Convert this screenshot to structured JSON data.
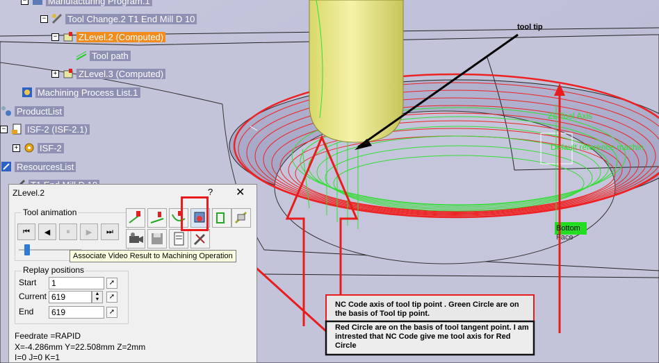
{
  "tree": {
    "items": [
      {
        "label": "Manufacturing Program.1",
        "selected": false
      },
      {
        "label": "Tool Change.2  T1 End Mill D 10",
        "selected": false
      },
      {
        "label": "ZLevel.2 (Computed)",
        "selected": true
      },
      {
        "label": "Tool path",
        "selected": false
      },
      {
        "label": "ZLevel.3 (Computed)",
        "selected": false
      },
      {
        "label": "Machining Process List.1",
        "selected": false
      },
      {
        "label": "ProductList",
        "selected": false
      },
      {
        "label": "ISF-2 (ISF-2.1)",
        "selected": false
      },
      {
        "label": "ISF-2",
        "selected": false
      },
      {
        "label": "ResourcesList",
        "selected": false
      },
      {
        "label": "T1 End Mill D 10",
        "selected": false
      }
    ]
  },
  "viewport": {
    "tool_tip_label": "tool tip",
    "tool_axis_label": "ZL Tool Axis",
    "default_ref_label": "Default reference machin",
    "bottom_label": "Bottom",
    "bottom_label_2": "Face",
    "colors": {
      "background": "#c9cadd",
      "tool": "#e9e88a",
      "green_path": "#33dd33",
      "red_path": "#ee2222",
      "annotation_red": "#e81c1c"
    }
  },
  "annotations": {
    "box1": "NC Code axis of tool tip point . Green Circle are on the basis of Tool tip point.",
    "box2": "Red Circle are on the basis of tool tangent point. I am intrested that NC Code give me tool axis for Red Circle"
  },
  "dialog": {
    "title": "ZLevel.2",
    "help": "?",
    "close": "✕",
    "tool_animation_label": "Tool animation",
    "replay_label": "Replay positions",
    "start_label": "Start",
    "start_value": "1",
    "current_label": "Current",
    "current_value": "619",
    "end_label": "End",
    "end_value": "619",
    "slider_position": 0.1,
    "tooltip": "Associate Video Result to Machining Operation",
    "feedrate": "Feedrate =RAPID",
    "xyz": "X=-4.286mm Y=22.508mm Z=2mm",
    "ijk": "I=0 J=0 K=1",
    "player_buttons": [
      {
        "name": "fast-backward",
        "glyph": "⏮"
      },
      {
        "name": "step-backward",
        "glyph": "◀"
      },
      {
        "name": "pause",
        "glyph": "⏸"
      },
      {
        "name": "step-forward",
        "glyph": "▶"
      },
      {
        "name": "fast-forward",
        "glyph": "⏭"
      }
    ]
  }
}
